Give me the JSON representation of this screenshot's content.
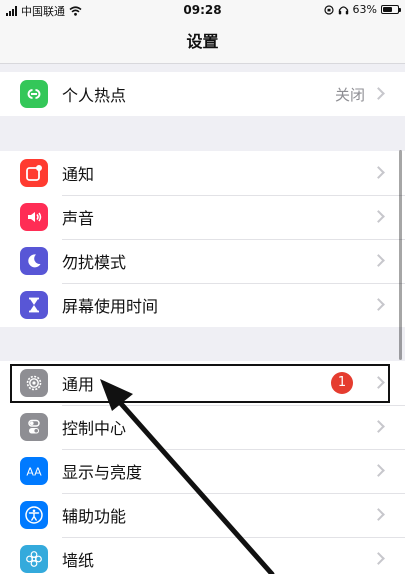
{
  "status_bar": {
    "carrier": "中国联通",
    "time": "09:28",
    "battery_percent": "63%",
    "battery_level": 0.63
  },
  "nav": {
    "title": "设置"
  },
  "groups": [
    {
      "rows": [
        {
          "label": "个人热点",
          "value": "关闭",
          "icon": "hotspot-icon",
          "icon_color": "#34c759"
        }
      ]
    },
    {
      "rows": [
        {
          "label": "通知",
          "icon": "notifications-icon",
          "icon_color": "#ff3b30"
        },
        {
          "label": "声音",
          "icon": "sounds-icon",
          "icon_color": "#ff2d55"
        },
        {
          "label": "勿扰模式",
          "icon": "moon-icon",
          "icon_color": "#5856d6"
        },
        {
          "label": "屏幕使用时间",
          "icon": "hourglass-icon",
          "icon_color": "#5856d6"
        }
      ]
    },
    {
      "rows": [
        {
          "label": "通用",
          "badge": "1",
          "icon": "gear-icon",
          "icon_color": "#8e8e93"
        },
        {
          "label": "控制中心",
          "icon": "switches-icon",
          "icon_color": "#8e8e93"
        },
        {
          "label": "显示与亮度",
          "icon": "display-icon",
          "icon_color": "#007aff"
        },
        {
          "label": "辅助功能",
          "icon": "accessibility-icon",
          "icon_color": "#007aff"
        },
        {
          "label": "墙纸",
          "icon": "wallpaper-icon",
          "icon_color": "#34aadc"
        }
      ]
    }
  ]
}
